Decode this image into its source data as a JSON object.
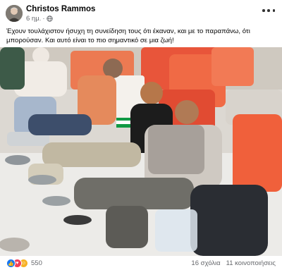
{
  "post": {
    "author": "Christos Rammos",
    "time": "6 ημ.",
    "separator": "·",
    "caption": "Έχουν τουλάχιστον ήσυχη τη συνείδηση τους ότι έκαναν, και με το παραπάνω,  ότι μπορούσαν. Και αυτό είναι το πιο σημαντικό σε μια ζωή!",
    "reaction_count": "550",
    "comments": "16 σχόλια",
    "shares": "11 κοινοποιήσεις",
    "icons": {
      "privacy": "globe-icon",
      "more": "more-options-icon",
      "like": "like-icon",
      "love": "love-icon",
      "care": "care-icon"
    }
  }
}
